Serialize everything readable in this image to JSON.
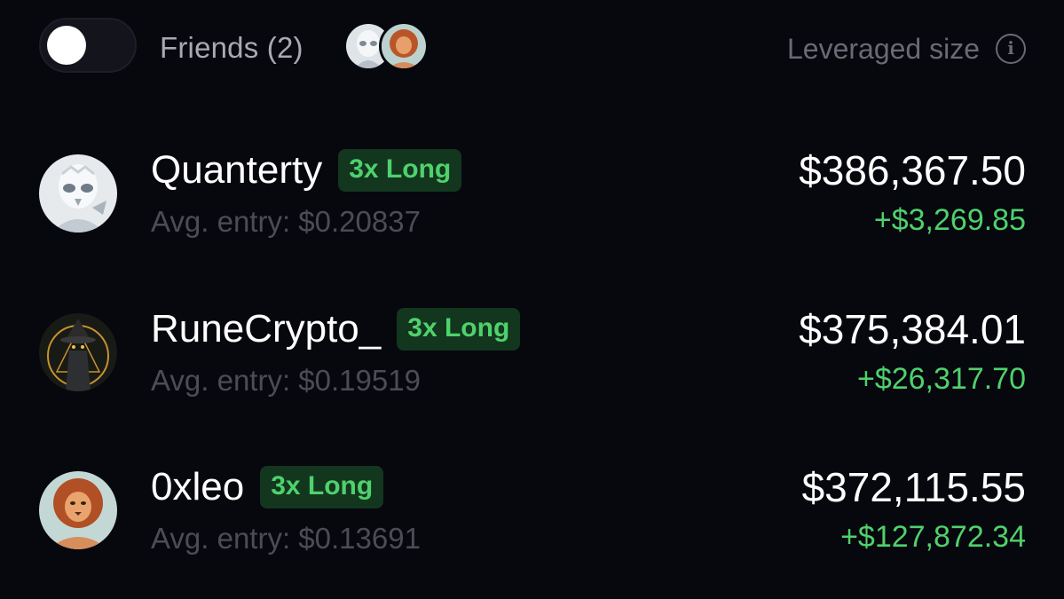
{
  "header": {
    "toggle_on": false,
    "friends_label": "Friends (2)",
    "leveraged_label": "Leveraged size",
    "info_icon": "info-circle-icon"
  },
  "friend_avatars": [
    "avatar-robot",
    "avatar-lion"
  ],
  "colors": {
    "background": "#07070e",
    "positive": "#4fd16c",
    "badge_bg": "#13361f",
    "muted": "#4c4c56"
  },
  "rows": [
    {
      "name": "Quanterty",
      "badge": "3x Long",
      "entry": "Avg. entry: $0.20837",
      "size": "$386,367.50",
      "pnl": "+$3,269.85",
      "avatar": "avatar-robot"
    },
    {
      "name": "RuneCrypto_",
      "badge": "3x Long",
      "entry": "Avg. entry: $0.19519",
      "size": "$375,384.01",
      "pnl": "+$26,317.70",
      "avatar": "avatar-wizard"
    },
    {
      "name": "0xleo",
      "badge": "3x Long",
      "entry": "Avg. entry: $0.13691",
      "size": "$372,115.55",
      "pnl": "+$127,872.34",
      "avatar": "avatar-lion"
    }
  ]
}
